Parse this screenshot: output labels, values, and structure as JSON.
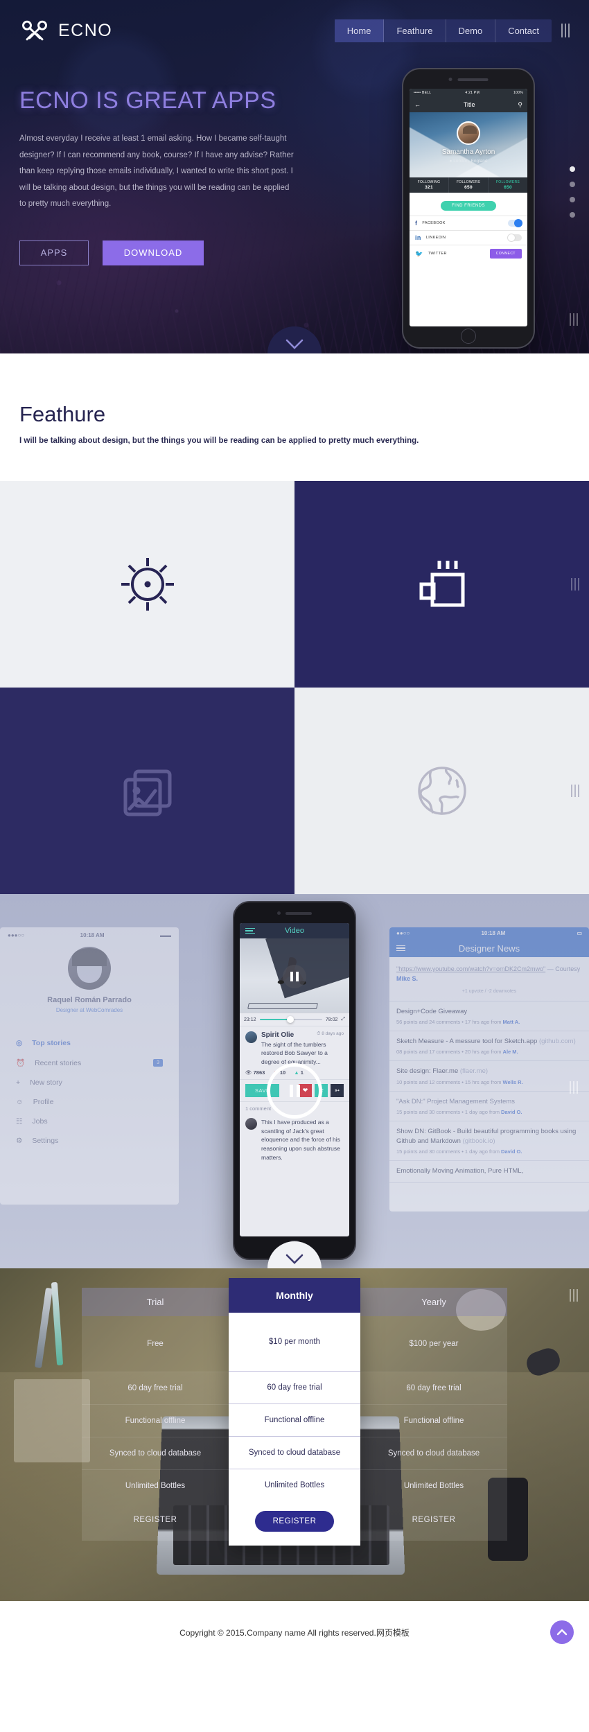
{
  "brand": {
    "name": "ECNO",
    "logo_icon": "knot-logo-icon"
  },
  "nav": {
    "items": [
      {
        "label": "Home",
        "active": true
      },
      {
        "label": "Feathure",
        "active": false
      },
      {
        "label": "Demo",
        "active": false
      },
      {
        "label": "Contact",
        "active": false
      }
    ],
    "menu_icon": "hamburger-icon"
  },
  "hero": {
    "title": "ECNO IS GREAT APPS",
    "paragraph": "Almost everyday I receive at least 1 email asking. How I became self-taught designer? If I can recommend any book, course? If I have any advise? Rather than keep replying those emails individually, I wanted to write this short post. I will be talking about design, but the things you will be reading can be applied to pretty much everything.",
    "btn_secondary": "APPS",
    "btn_primary": "DOWNLOAD",
    "accent_color": "#8c6ce8",
    "phone": {
      "status_left": "••••• BELL",
      "status_time": "4:21 PM",
      "status_right": "100%",
      "nav_title": "Title",
      "back_icon": "arrow-left-icon",
      "search_icon": "search-icon",
      "user_name": "Samantha Ayrton",
      "user_location": "London, England",
      "location_icon": "map-pin-icon",
      "stats": [
        {
          "label": "FOLLOWING",
          "value": "321"
        },
        {
          "label": "FOLLOWERS",
          "value": "650"
        },
        {
          "label": "FOLLOWERS",
          "value": "650"
        }
      ],
      "find_friends": "FIND FRIENDS",
      "socials": [
        {
          "name": "FACEBOOK",
          "icon": "facebook-icon",
          "control": "toggle-on"
        },
        {
          "name": "LINKEDIN",
          "icon": "linkedin-icon",
          "control": "toggle-off"
        },
        {
          "name": "TWITTER",
          "icon": "twitter-icon",
          "control": "button",
          "button_label": "CONNECT"
        }
      ]
    }
  },
  "feature": {
    "title": "Feathure",
    "subtitle": "I will be talking about design, but the things you will be reading can be applied to pretty much everything.",
    "cells": [
      {
        "icon": "sun-icon",
        "theme": "light"
      },
      {
        "icon": "coffee-cup-icon",
        "theme": "dark"
      },
      {
        "icon": "image-gallery-icon",
        "theme": "dark"
      },
      {
        "icon": "globe-icon",
        "theme": "light"
      }
    ]
  },
  "demo": {
    "left_phone": {
      "status_time": "10:18 AM",
      "user_name": "Raquel Román Parrado",
      "user_role": "Designer at WebComrades",
      "menu": [
        {
          "label": "Top stories",
          "icon": "target-icon",
          "active": true,
          "badge": ""
        },
        {
          "label": "Recent stories",
          "icon": "clock-icon",
          "active": false,
          "badge": "3"
        },
        {
          "label": "New story",
          "icon": "plus-icon",
          "active": false,
          "badge": ""
        },
        {
          "label": "Profile",
          "icon": "user-icon",
          "active": false,
          "badge": ""
        },
        {
          "label": "Jobs",
          "icon": "briefcase-icon",
          "active": false,
          "badge": ""
        },
        {
          "label": "Settings",
          "icon": "gear-icon",
          "active": false,
          "badge": ""
        }
      ]
    },
    "center_phone": {
      "title": "Video",
      "menu_icon": "hamburger-icon",
      "pause_icon": "pause-icon",
      "time_current": "23:12",
      "time_total": "78:02",
      "expand_icon": "expand-icon",
      "post_title": "Spirit Olie",
      "post_time": "8 days ago",
      "post_time_icon": "clock-icon",
      "post_body": "The sight of the tumblers restored Bob Sawyer to a degree of equanimity...",
      "views_icon": "eye-icon",
      "views": "7863",
      "downvotes": "10",
      "upvotes": "1",
      "save_label": "SAVE",
      "actions": [
        {
          "icon": "heart-icon",
          "color": "#cf4452"
        },
        {
          "icon": "star-icon",
          "color": "#3fc6b4"
        },
        {
          "icon": "share-icon",
          "color": "#2c3347"
        }
      ],
      "comments_label": "1 comment",
      "comment_text": "This I have produced as a scantling of Jack’s great eloquence and the force of his reasoning upon such abstruse matters."
    },
    "right_phone": {
      "status_time": "10:18 AM",
      "title": "Designer News",
      "menu_icon": "hamburger-icon",
      "quote": {
        "url": "\"https://www.youtube.com/watch?v=omDK2Cm2mwo\"",
        "courtesy_prefix": " — Courtesy ",
        "courtesy_name": "Mike S.",
        "votes": "+1 upvote / -2 downvotes"
      },
      "items": [
        {
          "title": "Design+Code Giveaway",
          "domain": "",
          "meta": "56 points and 24 comments  •  17 hrs ago from ",
          "author": "Matt A."
        },
        {
          "title": "Sketch Measure - A messure tool for Sketch.app",
          "domain": "(github.com)",
          "meta": "08 points and 17 comments  •  20 hrs ago from ",
          "author": "Ale M."
        },
        {
          "title": "Site design: Flaer.me",
          "domain": "(flaer.me)",
          "meta": "10 points and 12 comments  •  15 hrs ago from ",
          "author": "Wells R."
        },
        {
          "title": "\"Ask DN:\" Project Management Systems",
          "domain": "",
          "meta": "15 points and 30 comments  •  1 day ago from ",
          "author": "David O."
        },
        {
          "title": "Show DN: GitBook - Build beautiful programming books using Github and Markdown",
          "domain": "(gitbook.io)",
          "meta": "15 points and 30 comments  •  1 day ago from ",
          "author": "David O."
        },
        {
          "title": "Emotionally Moving Animation, Pure HTML,",
          "domain": "",
          "meta": "",
          "author": ""
        }
      ]
    }
  },
  "pricing": {
    "plans": [
      {
        "name": "Trial",
        "featured": false,
        "price": "Free",
        "features": [
          "60 day free trial",
          "Functional offline",
          "Synced to cloud database",
          "Unlimited Bottles"
        ],
        "cta": "REGISTER"
      },
      {
        "name": "Monthly",
        "featured": true,
        "price": "$10 per month",
        "features": [
          "60 day free trial",
          "Functional offline",
          "Synced to cloud database",
          "Unlimited Bottles"
        ],
        "cta": "REGISTER"
      },
      {
        "name": "Yearly",
        "featured": false,
        "price": "$100 per year",
        "features": [
          "60 day free trial",
          "Functional offline",
          "Synced to cloud database",
          "Unlimited Bottles"
        ],
        "cta": "REGISTER"
      }
    ]
  },
  "footer": {
    "copyright": "Copyright © 2015.Company name All rights reserved.网页模板",
    "to_top_icon": "chevron-up-icon"
  }
}
